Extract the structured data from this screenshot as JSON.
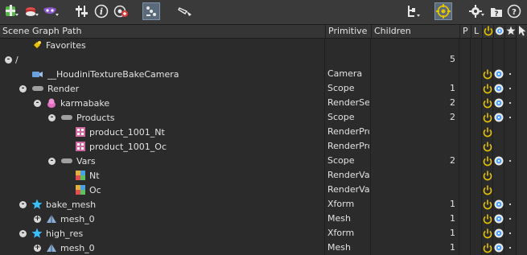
{
  "colors": {
    "accent": "#e6c200",
    "eye": "#4aa0ff",
    "star": "#39c0ff",
    "bg": "#2b2b2b",
    "toolbar": "#3a3a3a"
  },
  "toolbar": {
    "left_icons": [
      "add-prim-icon",
      "layer-icon",
      "mask-icon",
      "sliders-icon",
      "info-icon",
      "target-add-icon",
      "link-toggle-icon",
      "brush-icon"
    ],
    "right_icons": [
      "tree-icon",
      "pin-icon",
      "gear-icon",
      "folder-help-icon",
      "help-icon"
    ]
  },
  "columns": {
    "path": "Scene Graph Path",
    "primitive": "Primitive",
    "children": "Children",
    "p": "P",
    "l": "L",
    "power": "power-icon",
    "eye": "eye-icon",
    "star": "star-icon",
    "cursor": "cursor-icon"
  },
  "rows": [
    {
      "name": "Favorites",
      "primitive": "",
      "children": "",
      "icon": "favorites-icon",
      "depth": 1,
      "exp": "",
      "flags": false
    },
    {
      "name": "/",
      "primitive": "",
      "children": "5",
      "icon": "",
      "depth": 0,
      "exp": "-",
      "flags": false
    },
    {
      "name": "__HoudiniTextureBakeCamera",
      "primitive": "Camera",
      "children": "",
      "icon": "camera-icon",
      "depth": 1,
      "exp": "",
      "flags": true
    },
    {
      "name": "Render",
      "primitive": "Scope",
      "children": "1",
      "icon": "scope-icon",
      "depth": 1,
      "exp": "-",
      "flags": true
    },
    {
      "name": "karmabake",
      "primitive": "RenderSet",
      "children": "2",
      "icon": "renderset-icon",
      "depth": 2,
      "exp": "-",
      "flags": true
    },
    {
      "name": "Products",
      "primitive": "Scope",
      "children": "2",
      "icon": "scope-icon",
      "depth": 3,
      "exp": "-",
      "flags": true
    },
    {
      "name": "product_1001_Nt",
      "primitive": "RenderPro",
      "children": "",
      "icon": "renderproduct-icon",
      "depth": 4,
      "exp": "",
      "flags": "power"
    },
    {
      "name": "product_1001_Oc",
      "primitive": "RenderPro",
      "children": "",
      "icon": "renderproduct-icon",
      "depth": 4,
      "exp": "",
      "flags": "power"
    },
    {
      "name": "Vars",
      "primitive": "Scope",
      "children": "2",
      "icon": "scope-icon",
      "depth": 3,
      "exp": "-",
      "flags": true
    },
    {
      "name": "Nt",
      "primitive": "RenderVar",
      "children": "",
      "icon": "rendervar-icon",
      "depth": 4,
      "exp": "",
      "flags": "power"
    },
    {
      "name": "Oc",
      "primitive": "RenderVar",
      "children": "",
      "icon": "rendervar-icon",
      "depth": 4,
      "exp": "",
      "flags": "power"
    },
    {
      "name": "bake_mesh",
      "primitive": "Xform",
      "children": "1",
      "icon": "xform-icon",
      "depth": 1,
      "exp": "-",
      "flags": true
    },
    {
      "name": "mesh_0",
      "primitive": "Mesh",
      "children": "1",
      "icon": "mesh-icon",
      "depth": 2,
      "exp": "+",
      "flags": true
    },
    {
      "name": "high_res",
      "primitive": "Xform",
      "children": "1",
      "icon": "xform-icon",
      "depth": 1,
      "exp": "-",
      "flags": true
    },
    {
      "name": "mesh_0",
      "primitive": "Mesh",
      "children": "1",
      "icon": "mesh-icon",
      "depth": 2,
      "exp": "+",
      "flags": true
    }
  ]
}
